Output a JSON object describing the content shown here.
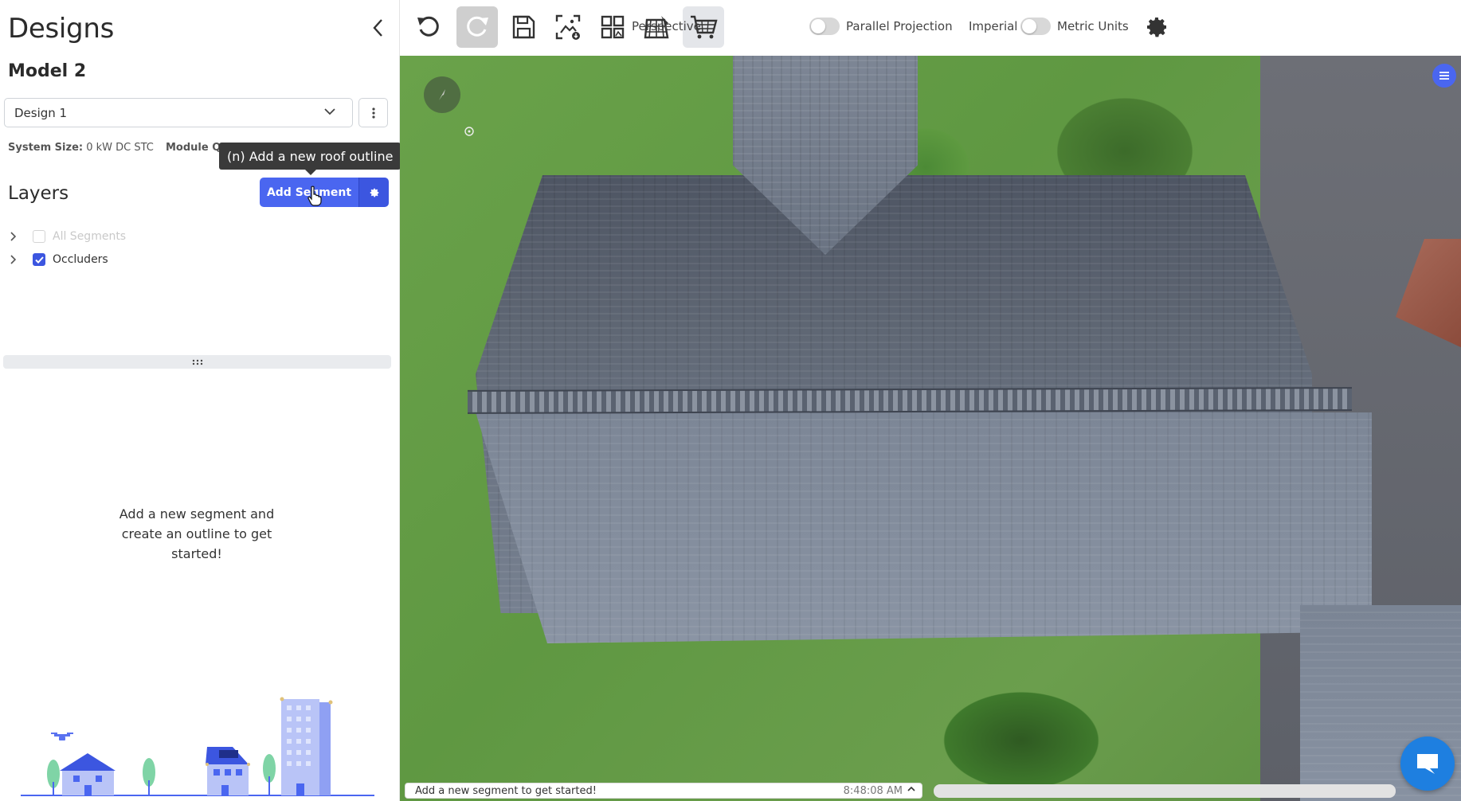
{
  "sidebar": {
    "title": "Designs",
    "model_title": "Model 2",
    "design_select": {
      "value": "Design 1"
    },
    "system_size_label": "System Size:",
    "system_size_value": "0 kW DC STC",
    "module_label": "Module Q",
    "tooltip": "(n) Add a new roof outline",
    "layers_title": "Layers",
    "add_segment_label": "Add Segment",
    "layers": [
      {
        "label": "All Segments",
        "checked": false
      },
      {
        "label": "Occluders",
        "checked": true
      }
    ],
    "empty_message": "Add a new segment and create an outline to get started!"
  },
  "toolbar": {
    "perspective_label": "Perspective",
    "parallel_label": "Parallel Projection",
    "imperial_label": "Imperial",
    "metric_label": "Metric Units"
  },
  "status": {
    "message": "Add a new segment to get started!",
    "time": "8:48:08 AM"
  },
  "colors": {
    "accent": "#4a66f0",
    "accent_dark": "#3c56e0",
    "chat": "#1e7fe0"
  },
  "icons": {
    "undo": "undo-icon",
    "redo": "redo-icon",
    "save": "save-icon",
    "export_image": "export-image-icon",
    "layout_grid": "layout-grid-icon",
    "edit_panels": "edit-panels-icon",
    "cart": "cart-icon",
    "settings": "gear-icon"
  }
}
